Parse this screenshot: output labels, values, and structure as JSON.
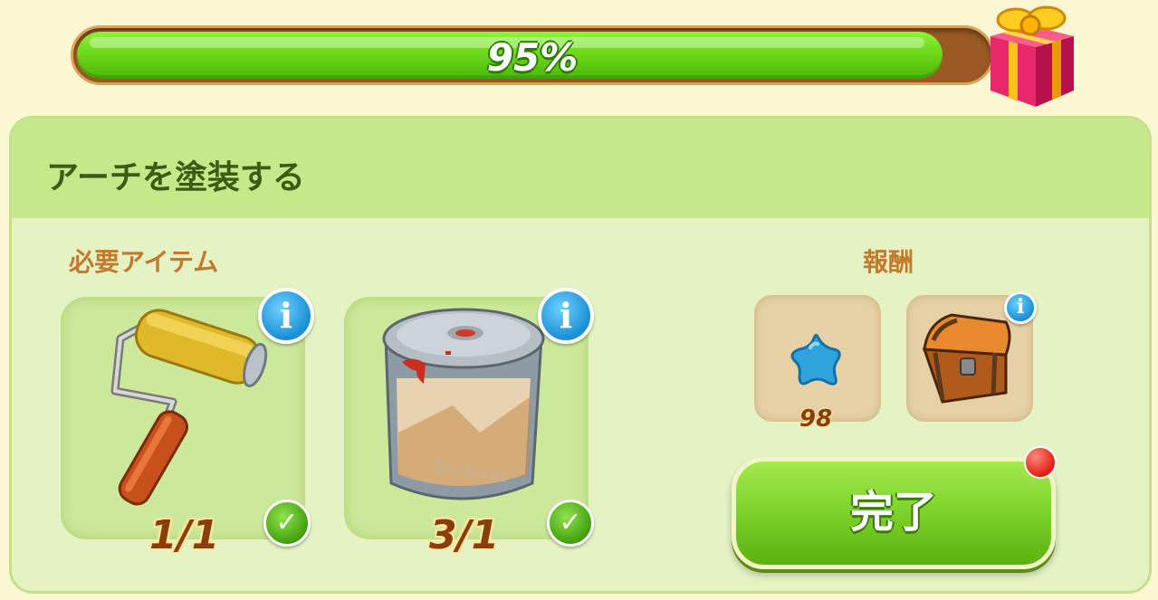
{
  "progress": {
    "percent_label": "95%",
    "fraction": 0.95
  },
  "task": {
    "title": "アーチを塗装する"
  },
  "required": {
    "label": "必要アイテム",
    "items": [
      {
        "icon": "paint-roller-icon",
        "count": "1/1",
        "complete": true
      },
      {
        "icon": "paint-can-icon",
        "count": "3/1",
        "complete": true,
        "can_label": "Technoi"
      }
    ]
  },
  "rewards": {
    "label": "報酬",
    "items": [
      {
        "icon": "blue-star-icon",
        "amount": "98"
      },
      {
        "icon": "treasure-chest-icon",
        "amount": ""
      }
    ]
  },
  "complete_button": {
    "label": "完了"
  },
  "colors": {
    "accent_green": "#6fd81a",
    "brown_text": "#8a3e0c",
    "label_orange": "#c47a2c"
  }
}
